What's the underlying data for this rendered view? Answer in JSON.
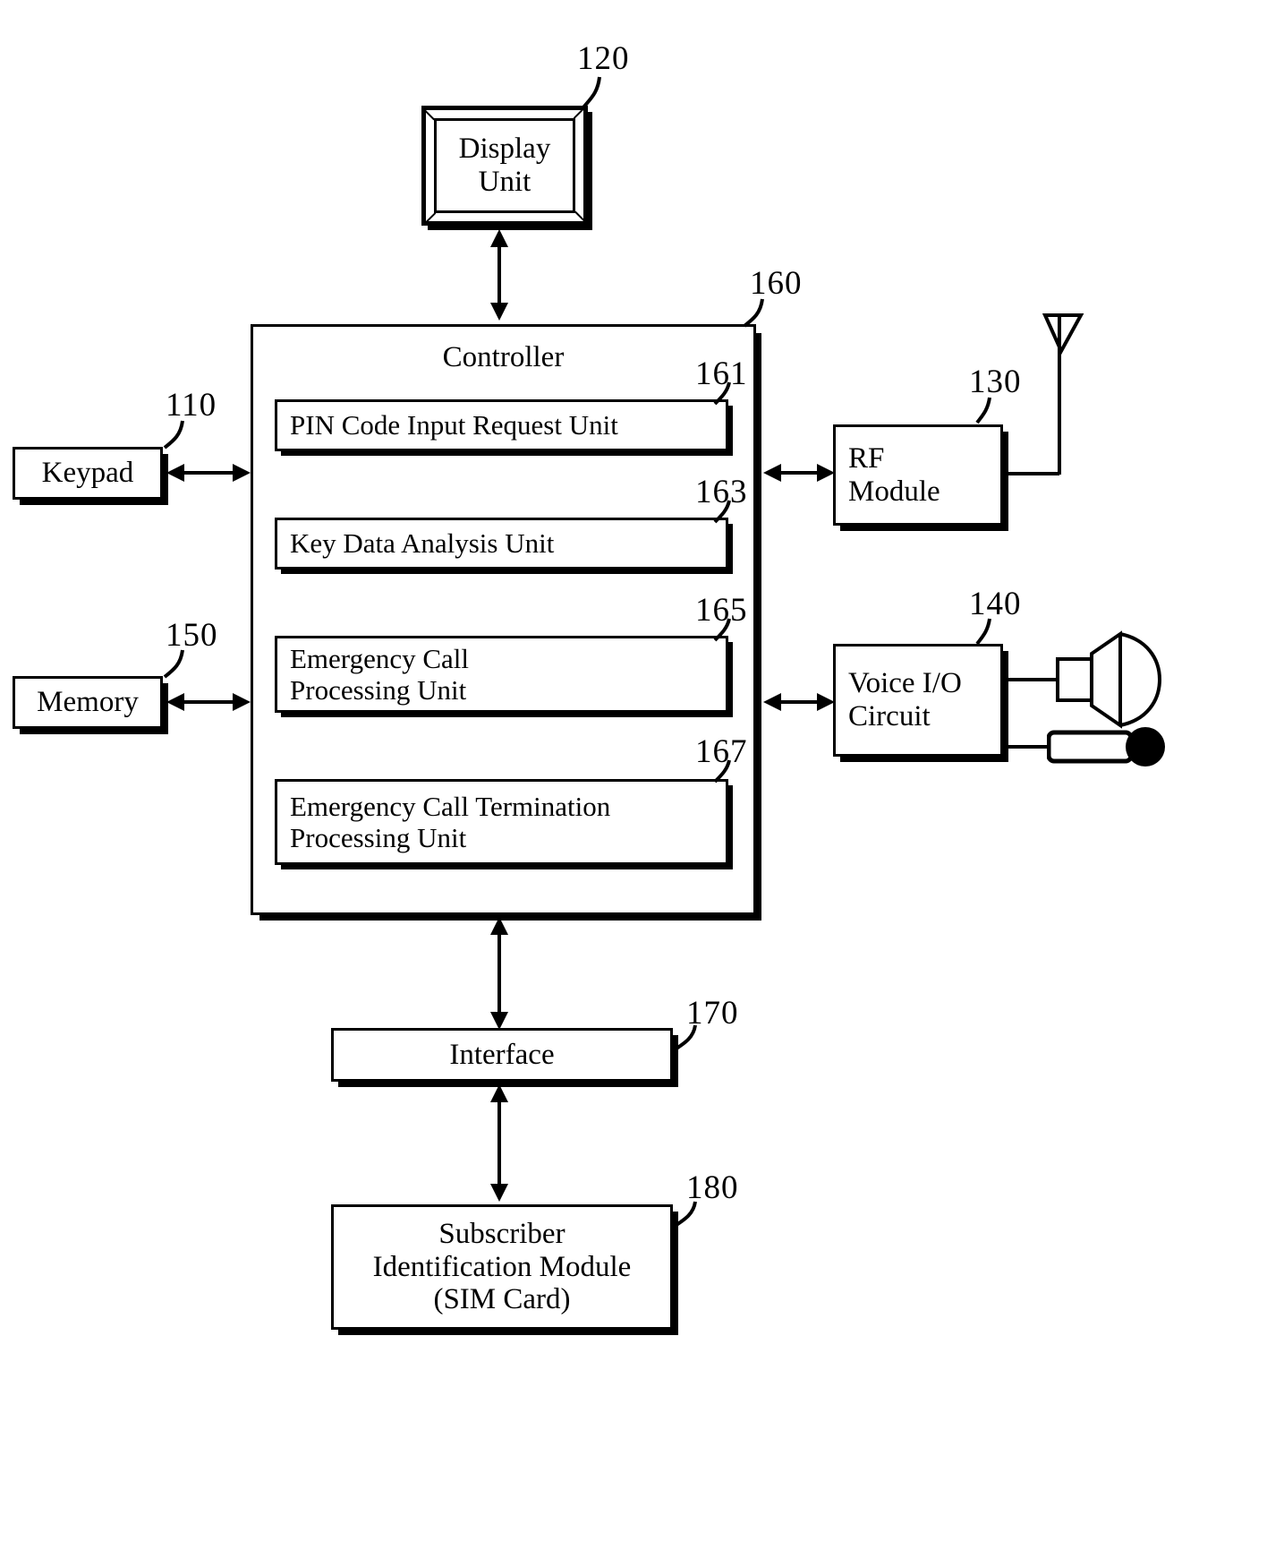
{
  "figure": {
    "type": "patent-block-diagram",
    "background_color": "#ffffff",
    "line_color": "#000000"
  },
  "blocks": {
    "display_unit": {
      "label": "Display\nUnit",
      "ref": "120"
    },
    "keypad": {
      "label": "Keypad",
      "ref": "110"
    },
    "memory": {
      "label": "Memory",
      "ref": "150"
    },
    "controller": {
      "label": "Controller",
      "ref": "160"
    },
    "rf_module": {
      "label": "RF\nModule",
      "ref": "130"
    },
    "voice_io": {
      "label": "Voice I/O\nCircuit",
      "ref": "140"
    },
    "interface": {
      "label": "Interface",
      "ref": "170"
    },
    "sim": {
      "label": "Subscriber\nIdentification Module\n(SIM Card)",
      "ref": "180"
    }
  },
  "controller_units": [
    {
      "label": "PIN Code Input Request Unit",
      "ref": "161"
    },
    {
      "label": "Key Data Analysis Unit",
      "ref": "163"
    },
    {
      "label": "Emergency Call\nProcessing Unit",
      "ref": "165"
    },
    {
      "label": "Emergency Call Termination\nProcessing Unit",
      "ref": "167"
    }
  ],
  "icons": [
    {
      "name": "antenna-icon",
      "attached_to": "rf_module"
    },
    {
      "name": "speaker-icon",
      "attached_to": "voice_io"
    },
    {
      "name": "microphone-icon",
      "attached_to": "voice_io"
    }
  ],
  "connections": [
    {
      "from": "controller",
      "to": "display_unit",
      "style": "double-arrow",
      "orientation": "vertical"
    },
    {
      "from": "keypad",
      "to": "controller",
      "style": "double-arrow",
      "orientation": "horizontal"
    },
    {
      "from": "memory",
      "to": "controller",
      "style": "double-arrow",
      "orientation": "horizontal"
    },
    {
      "from": "controller",
      "to": "rf_module",
      "style": "double-arrow",
      "orientation": "horizontal"
    },
    {
      "from": "controller",
      "to": "voice_io",
      "style": "double-arrow",
      "orientation": "horizontal"
    },
    {
      "from": "controller",
      "to": "interface",
      "style": "double-arrow",
      "orientation": "vertical"
    },
    {
      "from": "interface",
      "to": "sim",
      "style": "double-arrow",
      "orientation": "vertical"
    }
  ]
}
